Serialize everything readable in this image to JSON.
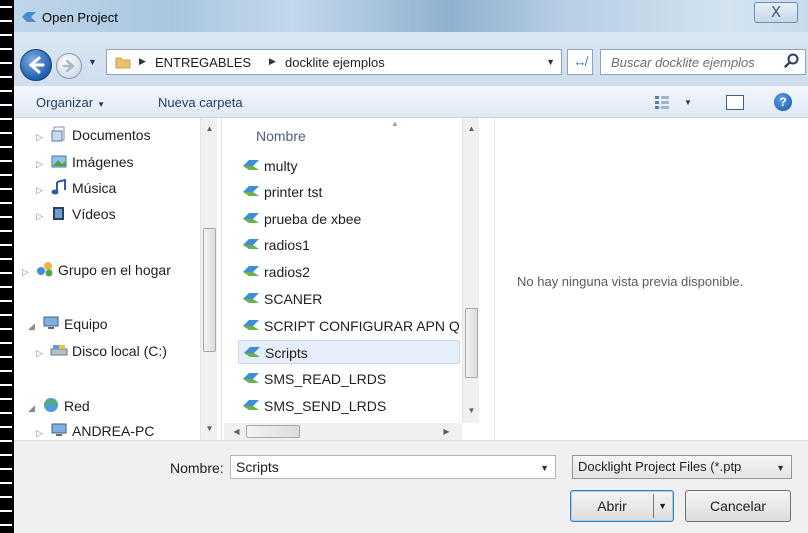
{
  "window": {
    "title": "Open Project",
    "close_symbol": "X"
  },
  "address": {
    "breadcrumbs": [
      "ENTREGABLES",
      "docklite ejemplos"
    ],
    "search_placeholder": "Buscar docklite ejemplos"
  },
  "toolbar": {
    "organize": "Organizar",
    "new_folder": "Nueva carpeta"
  },
  "nav": {
    "items": [
      {
        "label": "Documentos",
        "icon": "documents-icon"
      },
      {
        "label": "Imágenes",
        "icon": "pictures-icon"
      },
      {
        "label": "Música",
        "icon": "music-icon"
      },
      {
        "label": "Vídeos",
        "icon": "videos-icon"
      },
      {
        "label": "Grupo en el hogar",
        "icon": "homegroup-icon"
      },
      {
        "label": "Equipo",
        "icon": "computer-icon"
      },
      {
        "label": "Disco local (C:)",
        "icon": "drive-icon"
      },
      {
        "label": "Red",
        "icon": "network-icon"
      },
      {
        "label": "ANDREA-PC",
        "icon": "pc-icon"
      }
    ]
  },
  "files": {
    "column_header": "Nombre",
    "items": [
      "multy",
      "printer tst",
      "prueba de xbee",
      "radios1",
      "radios2",
      "SCANER",
      "SCRIPT CONFIGURAR  APN Q",
      "Scripts",
      "SMS_READ_LRDS",
      "SMS_SEND_LRDS"
    ],
    "selected": "Scripts"
  },
  "preview": {
    "message": "No hay ninguna vista previa disponible."
  },
  "footer": {
    "name_label": "Nombre:",
    "name_value": "Scripts",
    "filter": "Docklight Project Files (*.ptp",
    "open_label": "Abrir",
    "cancel_label": "Cancelar"
  },
  "colors": {
    "selection": "#e5eef9",
    "titlebar": "#a9c6e0"
  }
}
